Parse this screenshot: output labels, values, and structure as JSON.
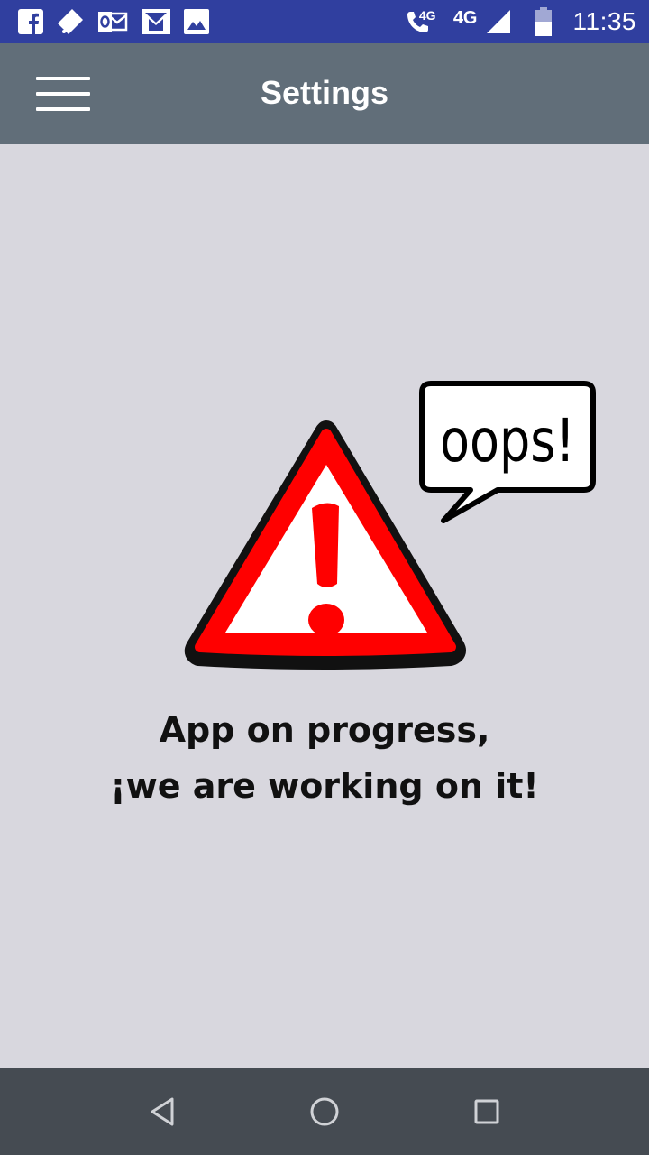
{
  "status_bar": {
    "network_call_label": "4G",
    "network_label": "4G",
    "time": "11:35",
    "notification_icons": [
      "facebook-icon",
      "tag-icon",
      "outlook-icon",
      "gmail-icon",
      "image-icon"
    ],
    "status_icons": [
      "wifi-call-icon",
      "signal-icon",
      "battery-icon"
    ]
  },
  "app_bar": {
    "title": "Settings",
    "menu_icon": "hamburger-menu-icon"
  },
  "content": {
    "bubble_text": "oops!",
    "message_line1": "App on progress,",
    "message_line2": "¡we are working on it!"
  },
  "colors": {
    "status_bar": "#303f9f",
    "app_bar": "#616e79",
    "background": "#d8d7de",
    "warning_red": "#ff0000",
    "nav_bar": "#454b52"
  },
  "nav_bar": {
    "buttons": [
      "back-icon",
      "home-icon",
      "recents-icon"
    ]
  }
}
